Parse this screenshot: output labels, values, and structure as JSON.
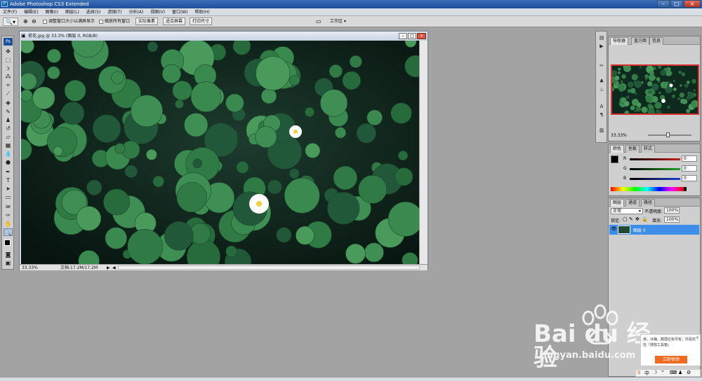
{
  "app": {
    "title": "Adobe Photoshop CS3 Extended"
  },
  "menu": [
    "文件(F)",
    "编辑(E)",
    "图像(I)",
    "图层(L)",
    "选择(S)",
    "滤镜(T)",
    "分析(A)",
    "视图(V)",
    "窗口(W)",
    "帮助(H)"
  ],
  "options": {
    "chk1": "调整窗口大小以满屏显示",
    "chk2": "缩放所有窗口",
    "btn_actual": "实际像素",
    "btn_fit": "适合屏幕",
    "btn_print": "打印尺寸",
    "workspace": "工作区 ▾"
  },
  "document": {
    "title": "荷花.jpg @ 33.3% (图层 0, RGB/8)",
    "zoom": "33.33%",
    "docinfo": "文档:17.2M/17.2M"
  },
  "navigator": {
    "tabs": [
      "导航器",
      "直方图",
      "信息"
    ],
    "zoom": "33.33%"
  },
  "color": {
    "tabs": [
      "颜色",
      "色板",
      "样式"
    ],
    "r_label": "R",
    "g_label": "G",
    "b_label": "B",
    "r": "0",
    "g": "0",
    "b": "0",
    "r_color": "#c81e1e",
    "g_color": "#22a52c",
    "b_color": "#1e3cd2"
  },
  "layers": {
    "tabs": [
      "图层",
      "通道",
      "路径"
    ],
    "blend": "正常",
    "opacity_label": "不透明度:",
    "opacity": "100%",
    "lock_label": "锁定:",
    "fill_label": "填充:",
    "fill": "100%",
    "layer_name": "图层 0"
  },
  "popup": {
    "text": "亲，冰桶、截屏应有尽有，你喜欢在『搜狗工具箱』",
    "button": "立即体验"
  },
  "watermark": {
    "brand": "Bai du 经验",
    "url": "jingyan.baidu.com"
  },
  "colors": {
    "accent": "#2f7fe0",
    "selected_layer": "#3d8ee8",
    "titlebar": "#2a5ea8"
  }
}
